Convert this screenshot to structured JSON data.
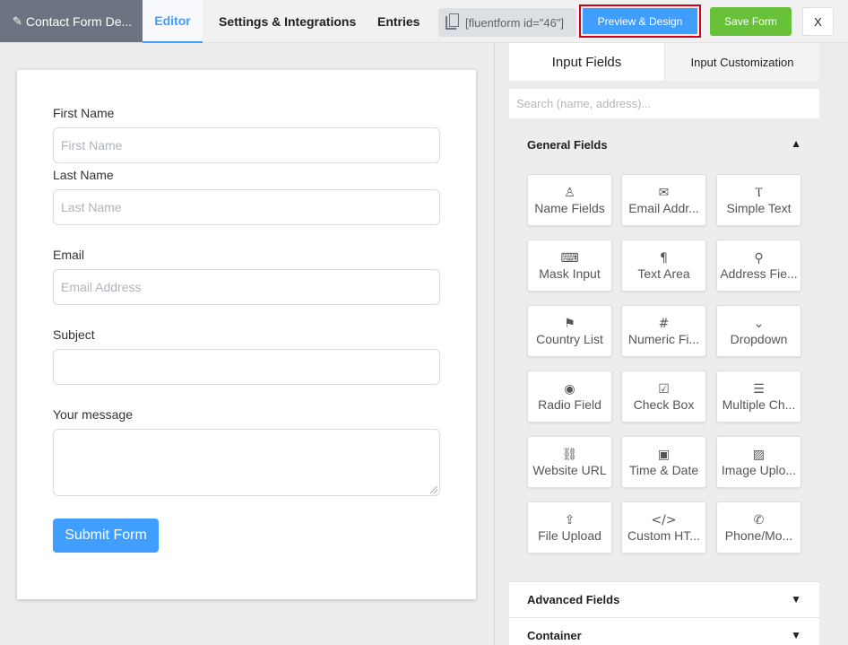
{
  "topbar": {
    "form_title": "Contact Form De...",
    "tabs": [
      "Editor",
      "Settings & Integrations",
      "Entries"
    ],
    "shortcode": "[fluentform id=\"46\"]",
    "preview_label": "Preview & Design",
    "save_label": "Save Form",
    "close_label": "X"
  },
  "form": {
    "first_name_label": "First Name",
    "first_name_placeholder": "First Name",
    "last_name_label": "Last Name",
    "last_name_placeholder": "Last Name",
    "email_label": "Email",
    "email_placeholder": "Email Address",
    "subject_label": "Subject",
    "message_label": "Your message",
    "submit_label": "Submit Form"
  },
  "sidebar": {
    "tabs": [
      "Input Fields",
      "Input Customization"
    ],
    "search_placeholder": "Search (name, address)...",
    "general_title": "General Fields",
    "fields": [
      {
        "label": "Name Fields",
        "icon": "user-icon",
        "glyph": "♙"
      },
      {
        "label": "Email Addr...",
        "icon": "envelope-icon",
        "glyph": "✉"
      },
      {
        "label": "Simple Text",
        "icon": "text-cursor-icon",
        "glyph": "Ⲧ"
      },
      {
        "label": "Mask Input",
        "icon": "keyboard-icon",
        "glyph": "⌨"
      },
      {
        "label": "Text Area",
        "icon": "paragraph-icon",
        "glyph": "¶"
      },
      {
        "label": "Address Fie...",
        "icon": "map-pin-icon",
        "glyph": "⚲"
      },
      {
        "label": "Country List",
        "icon": "flag-icon",
        "glyph": "⚑"
      },
      {
        "label": "Numeric Fi...",
        "icon": "hash-icon",
        "glyph": "#"
      },
      {
        "label": "Dropdown",
        "icon": "dropdown-icon",
        "glyph": "⌄"
      },
      {
        "label": "Radio Field",
        "icon": "radio-icon",
        "glyph": "◉"
      },
      {
        "label": "Check Box",
        "icon": "checkbox-icon",
        "glyph": "☑"
      },
      {
        "label": "Multiple Ch...",
        "icon": "list-icon",
        "glyph": "☰"
      },
      {
        "label": "Website URL",
        "icon": "link-icon",
        "glyph": "⛓"
      },
      {
        "label": "Time & Date",
        "icon": "calendar-icon",
        "glyph": "▣"
      },
      {
        "label": "Image Uplo...",
        "icon": "image-icon",
        "glyph": "▨"
      },
      {
        "label": "File Upload",
        "icon": "upload-icon",
        "glyph": "⇪"
      },
      {
        "label": "Custom HT...",
        "icon": "code-icon",
        "glyph": "</>"
      },
      {
        "label": "Phone/Mo...",
        "icon": "phone-icon",
        "glyph": "✆"
      }
    ],
    "advanced_title": "Advanced Fields",
    "container_title": "Container"
  },
  "colors": {
    "accent": "#409eff",
    "save": "#67c23a",
    "highlight_border": "#d3001b",
    "title_bg": "#6b7480"
  }
}
